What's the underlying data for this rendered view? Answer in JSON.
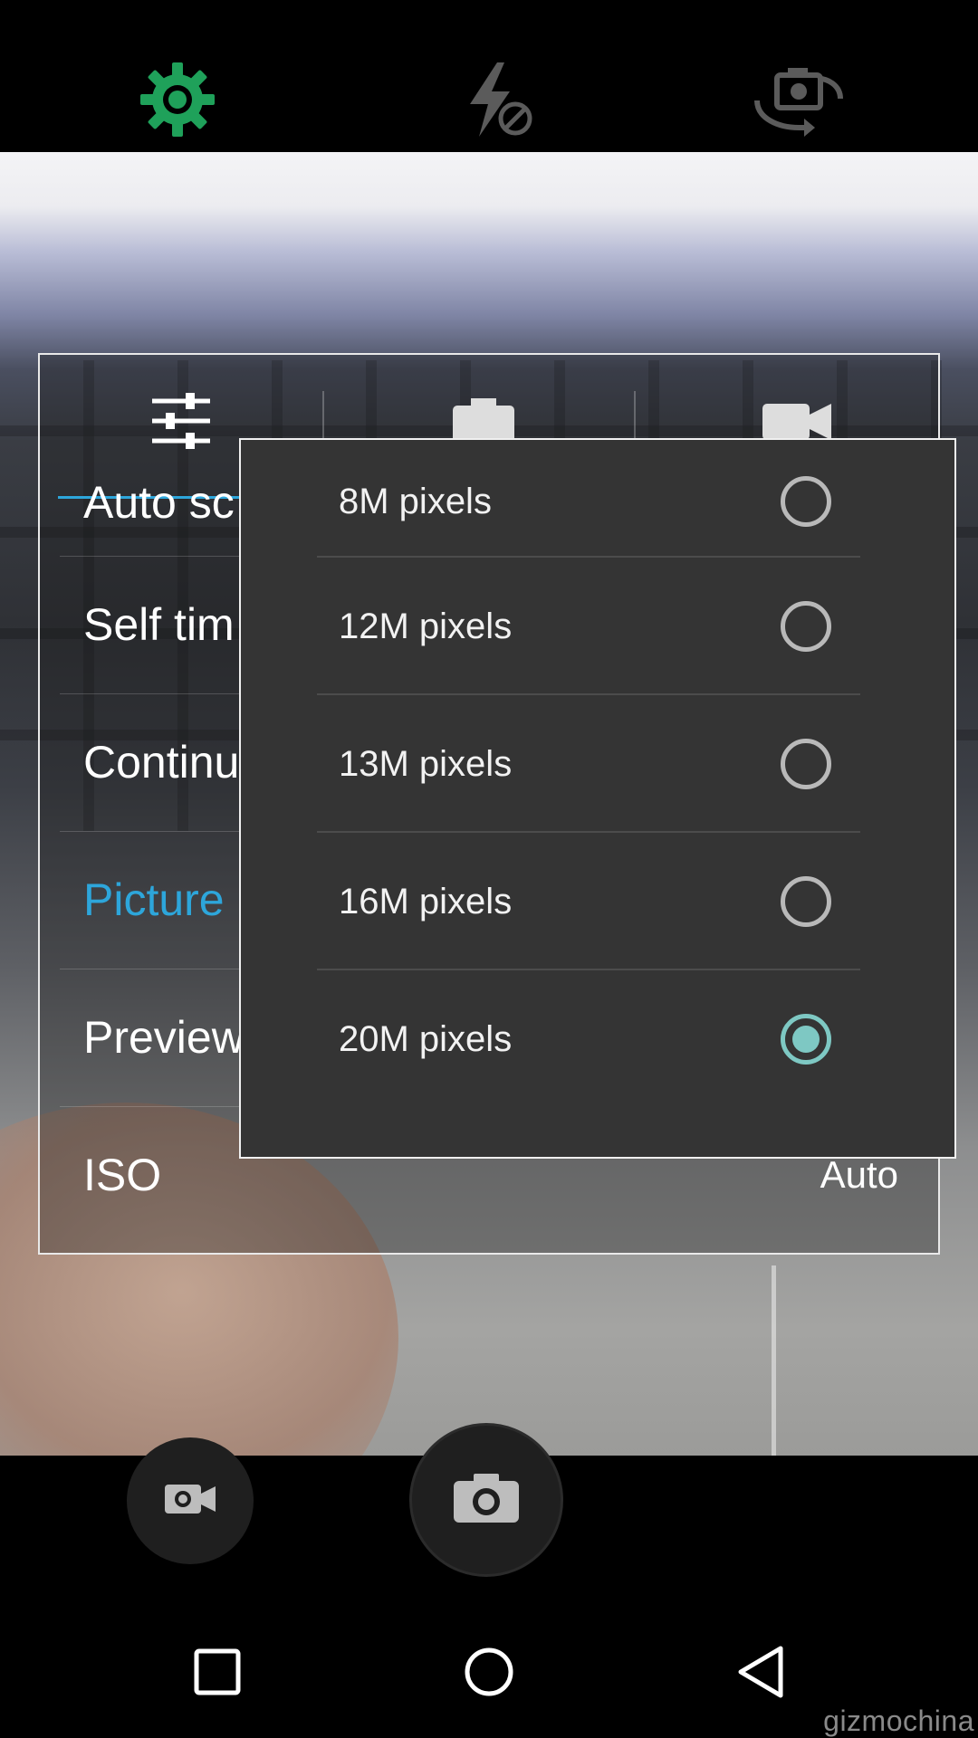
{
  "top_bar": {
    "icons": [
      "gear-icon",
      "flash-off-icon",
      "camera-switch-icon"
    ],
    "settings_color": "#1fa15a",
    "icon_color": "#6e6e6e"
  },
  "settings_panel": {
    "tabs": [
      "sliders-icon",
      "camera-icon",
      "video-icon"
    ],
    "rows": [
      {
        "label": "Auto sc",
        "value": ""
      },
      {
        "label": "Self tim",
        "value": ""
      },
      {
        "label": "Continu",
        "value": ""
      },
      {
        "label": "Picture",
        "value": ""
      },
      {
        "label": "Preview",
        "value": ""
      },
      {
        "label": "ISO",
        "value": "Auto"
      }
    ],
    "active_color": "#2da6db"
  },
  "popup": {
    "options": [
      {
        "label": "8M pixels",
        "selected": false
      },
      {
        "label": "12M pixels",
        "selected": false
      },
      {
        "label": "13M pixels",
        "selected": false
      },
      {
        "label": "16M pixels",
        "selected": false
      },
      {
        "label": "20M pixels",
        "selected": true
      }
    ],
    "selected_color": "#7ec8c3"
  },
  "controls": {
    "video_button_icon": "video-icon",
    "shutter_button_icon": "camera-icon"
  },
  "nav_bar": {
    "icons": [
      "recents-icon",
      "home-icon",
      "back-icon"
    ]
  },
  "watermark": "gizmochina"
}
